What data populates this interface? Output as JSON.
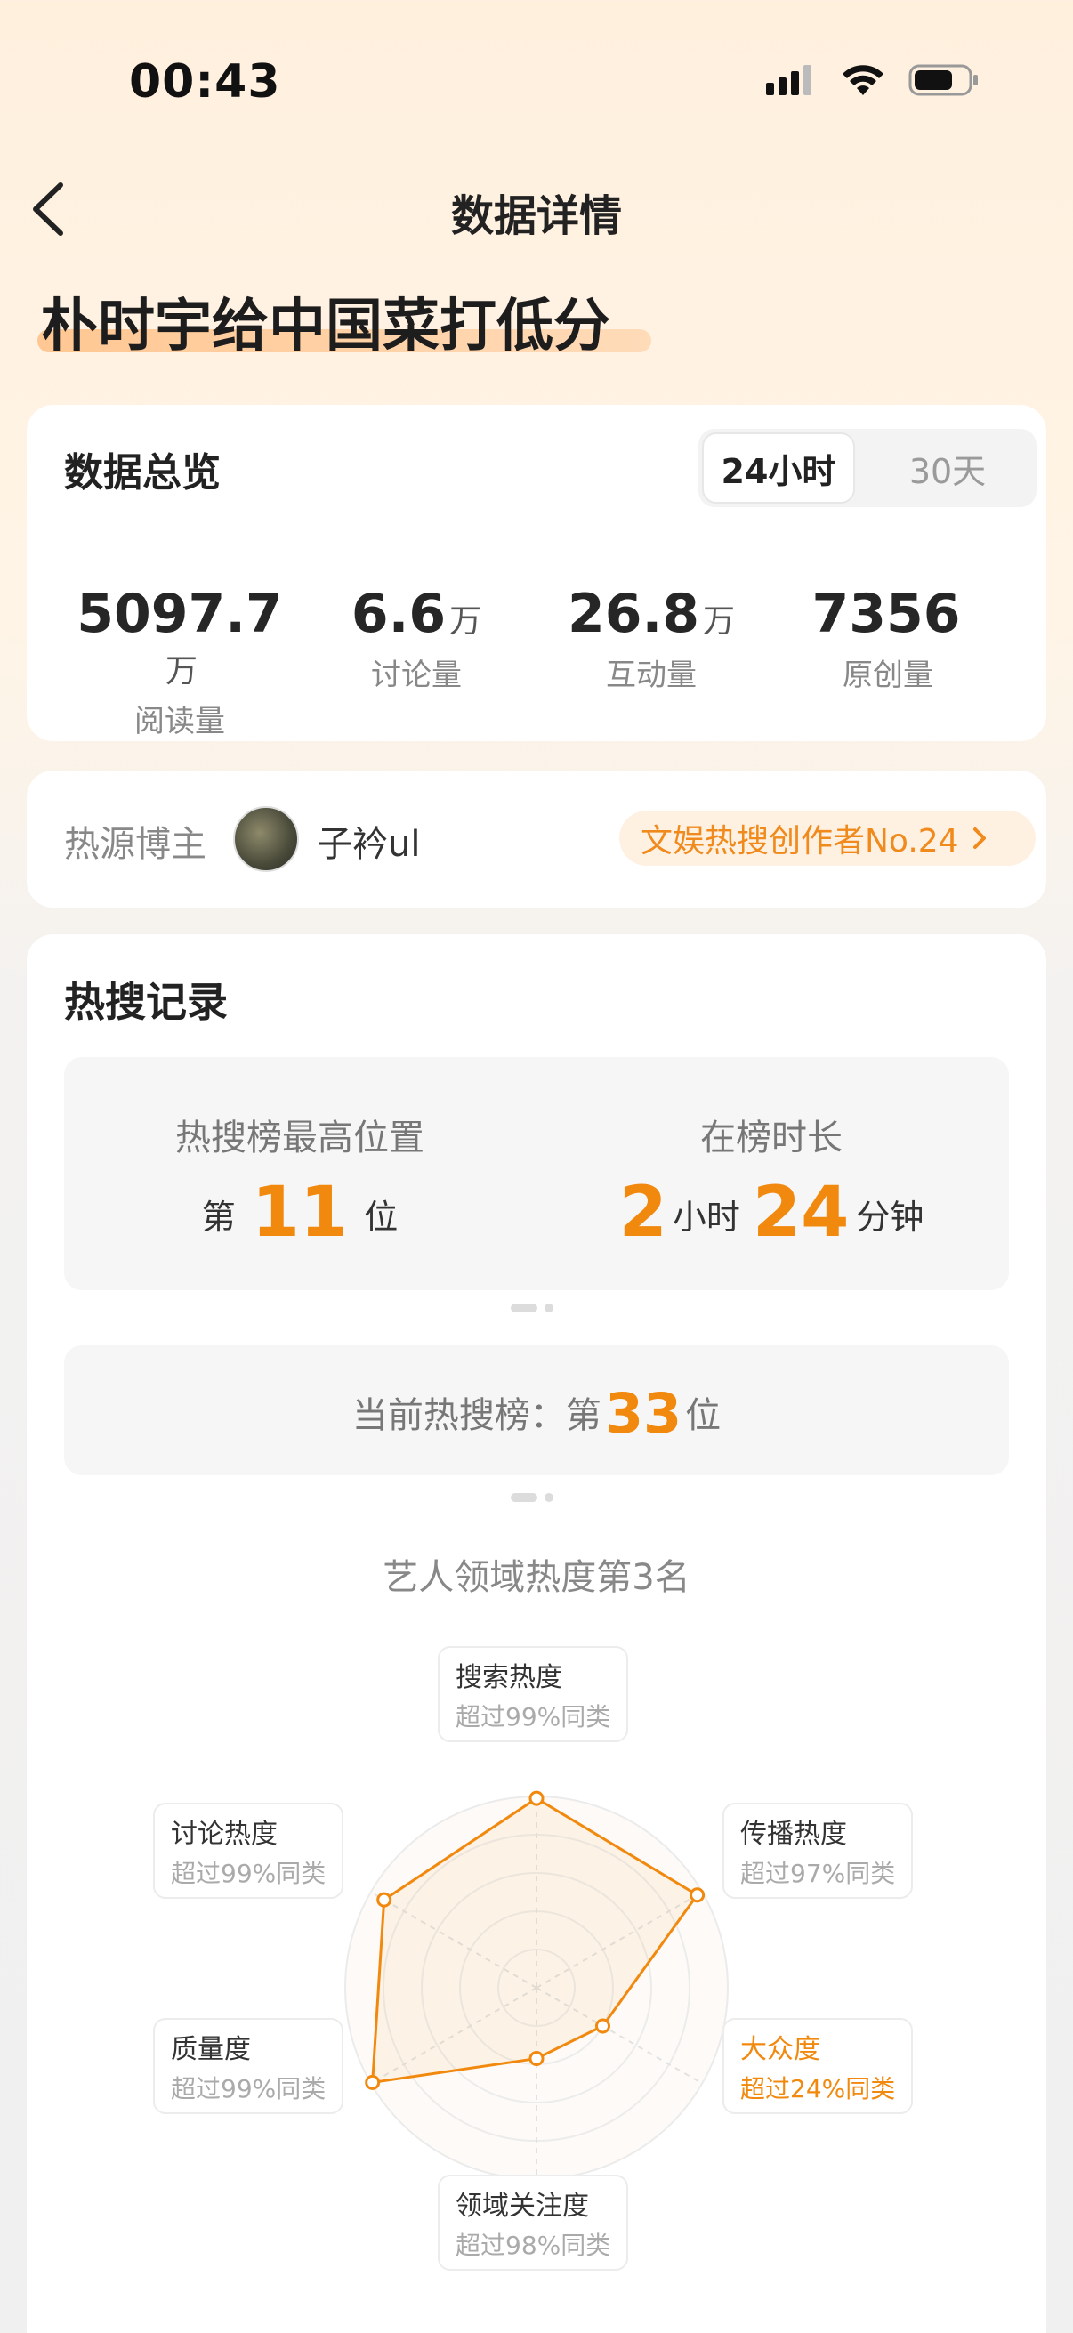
{
  "status_bar": {
    "time": "00:43"
  },
  "nav": {
    "title": "数据详情"
  },
  "topic": {
    "title": "朴时宇给中国菜打低分"
  },
  "overview": {
    "title": "数据总览",
    "tabs": [
      "24小时",
      "30天"
    ],
    "selected_tab": "24小时",
    "stats": [
      {
        "value": "5097.7",
        "unit": "万",
        "label": "阅读量"
      },
      {
        "value": "6.6",
        "unit": "万",
        "label": "讨论量"
      },
      {
        "value": "26.8",
        "unit": "万",
        "label": "互动量"
      },
      {
        "value": "7356",
        "unit": "",
        "label": "原创量"
      }
    ]
  },
  "blogger": {
    "label": "热源博主",
    "name": "子衿ul",
    "badge": "文娱热搜创作者No.24"
  },
  "hot_record": {
    "title": "热搜记录",
    "peak_label": "热搜榜最高位置",
    "peak_prefix": "第",
    "peak_value": "11",
    "peak_suffix": "位",
    "duration_label": "在榜时长",
    "duration_hours": "2",
    "hours_unit": "小时",
    "duration_minutes": "24",
    "minutes_unit": "分钟",
    "current_prefix": "当前热搜榜：第",
    "current_value": "33",
    "current_suffix": "位",
    "domain_rank": "艺人领域热度第3名"
  },
  "radar": {
    "metrics": [
      {
        "name": "搜索热度",
        "desc": "超过99%同类",
        "value": 0.99,
        "highlight": false
      },
      {
        "name": "传播热度",
        "desc": "超过97%同类",
        "value": 0.97,
        "highlight": false
      },
      {
        "name": "大众度",
        "desc": "超过24%同类",
        "value": 0.4,
        "highlight": true
      },
      {
        "name": "领域关注度",
        "desc": "超过98%同类",
        "value": 0.37,
        "highlight": false
      },
      {
        "name": "质量度",
        "desc": "超过99%同类",
        "value": 0.99,
        "highlight": false
      },
      {
        "name": "讨论热度",
        "desc": "超过99%同类",
        "value": 0.92,
        "highlight": false
      }
    ],
    "color": "#f2890f"
  }
}
